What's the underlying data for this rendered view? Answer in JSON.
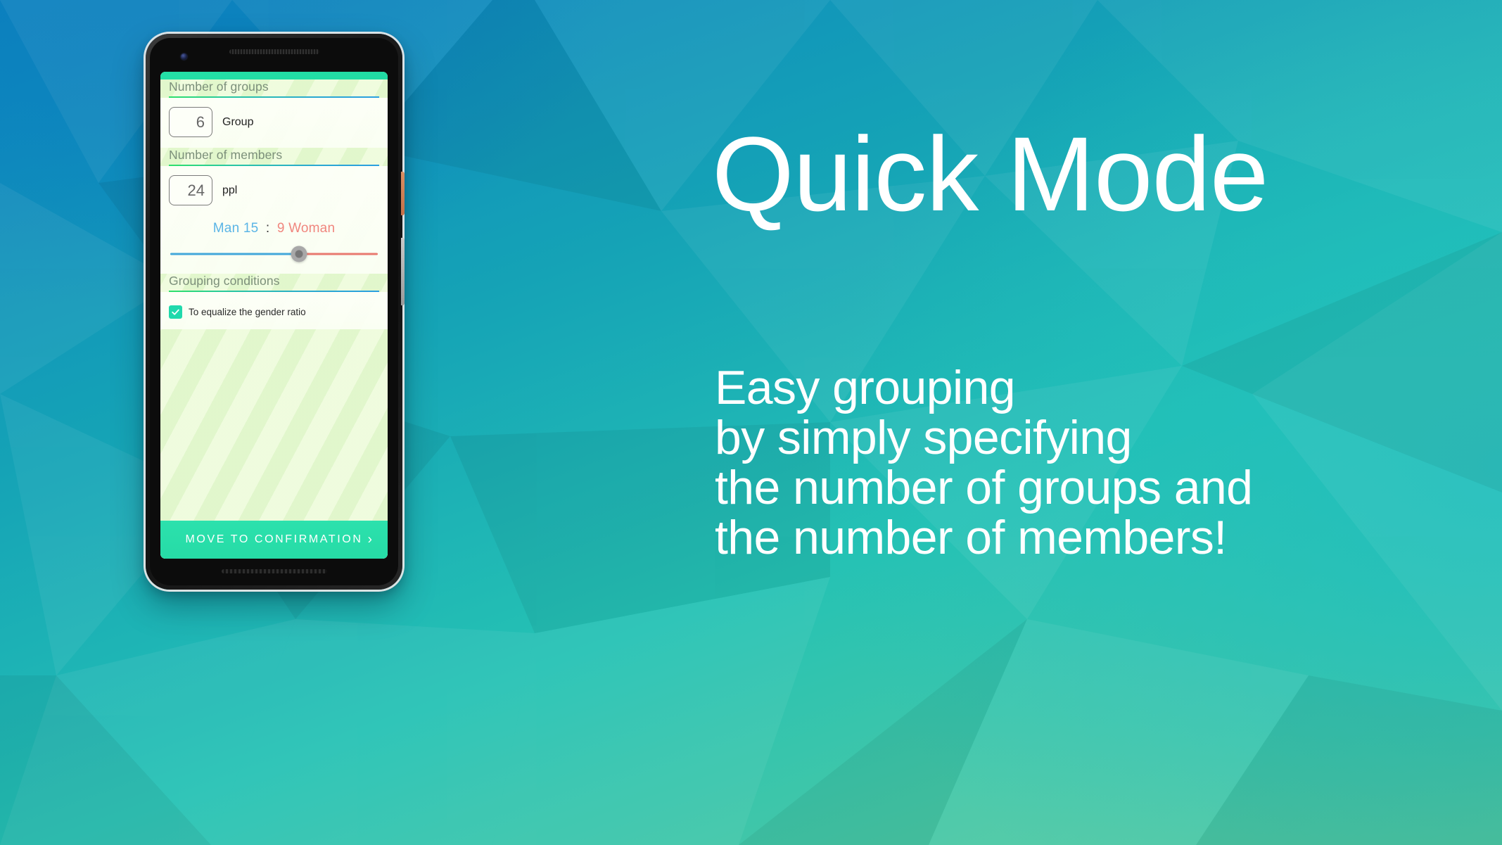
{
  "background": {
    "gradient_from": "#0c82c0",
    "gradient_mid": "#25c2b4",
    "gradient_to": "#5ecb9c",
    "style": "low-poly triangular facets"
  },
  "promo": {
    "headline": "Quick Mode",
    "body_lines": [
      "Easy grouping",
      "by simply specifying",
      "the number of groups and",
      "the number of members!"
    ],
    "text_color": "#ffffff"
  },
  "phone": {
    "frame_color": "#141414",
    "power_button_color": "#cf7d55",
    "volume_button_color": "#b5b5b5",
    "status_bar_color": "#24e0a6"
  },
  "app": {
    "accent_color": "#2ce1ad",
    "background_color": "#effce0",
    "sections": [
      {
        "title": "Number of groups",
        "value": "6",
        "unit": "Group"
      },
      {
        "title": "Number of members",
        "value": "24",
        "unit": "ppl"
      },
      {
        "title": "Grouping conditions"
      }
    ],
    "ratio": {
      "man_label": "Man",
      "man_count": "15",
      "separator": ":",
      "woman_count": "9",
      "woman_label": "Woman",
      "man_color": "#5bb5e6",
      "woman_color": "#f0867e",
      "slider_percent": 62
    },
    "condition": {
      "label": "To equalize the gender ratio",
      "checked": true,
      "checkbox_color": "#20d9ac"
    },
    "cta": {
      "label": "MOVE TO CONFIRMATION",
      "arrow": "›",
      "background_color": "#2ce1ad"
    }
  }
}
